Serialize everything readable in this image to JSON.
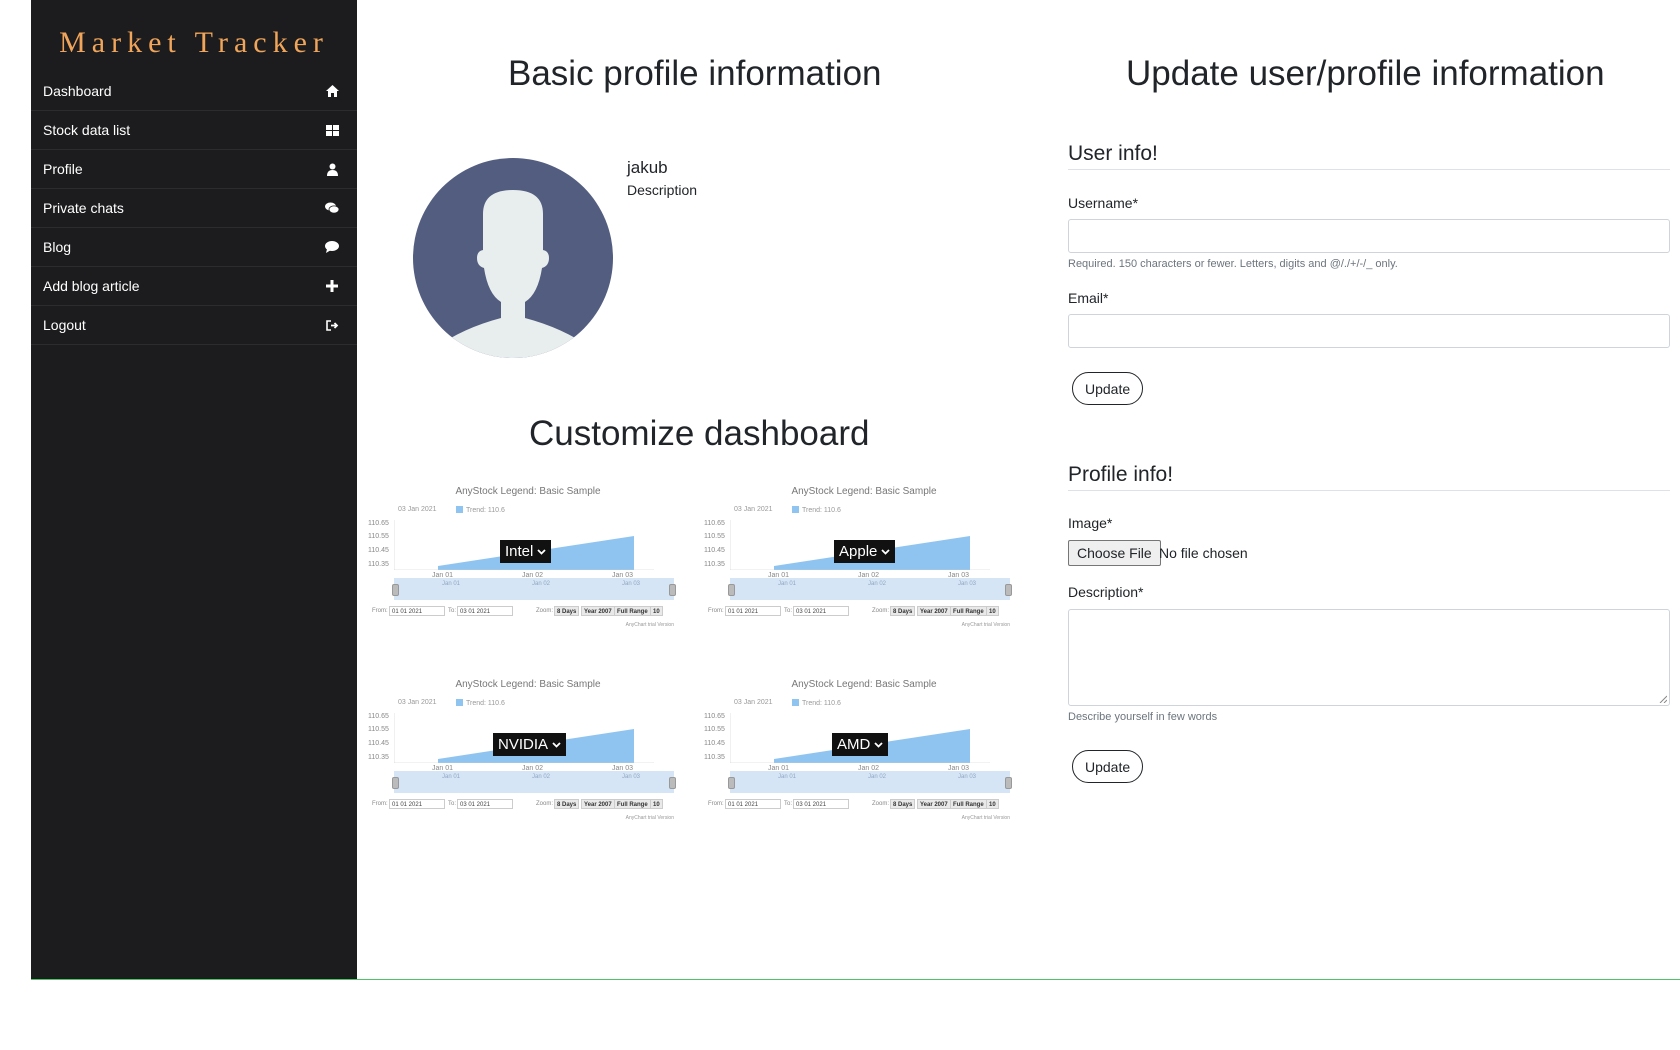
{
  "app": {
    "brand": "Market Tracker"
  },
  "sidebar": {
    "items": [
      {
        "label": "Dashboard",
        "icon": "home-icon"
      },
      {
        "label": "Stock data list",
        "icon": "grid-icon"
      },
      {
        "label": "Profile",
        "icon": "user-icon"
      },
      {
        "label": "Private chats",
        "icon": "comments-icon"
      },
      {
        "label": "Blog",
        "icon": "comment-icon"
      },
      {
        "label": "Add blog article",
        "icon": "plus-icon"
      },
      {
        "label": "Logout",
        "icon": "sign-out-icon"
      }
    ]
  },
  "profile": {
    "title": "Basic profile information",
    "username": "jakub",
    "description": "Description"
  },
  "dashboard": {
    "title": "Customize dashboard",
    "chart_template": {
      "title": "AnyStock Legend: Basic Sample",
      "date_label": "03 Jan 2021",
      "trend_label": "Trend: 110.6",
      "y_ticks": [
        "110.65",
        "110.55",
        "110.45",
        "110.35"
      ],
      "x_ticks": [
        "Jan 01",
        "Jan 02",
        "Jan 03"
      ],
      "from_label": "From:",
      "from_value": "01 01 2021",
      "to_label": "To:",
      "to_value": "03 01 2021",
      "zoom_label": "Zoom:",
      "zoom_buttons": [
        "8 Days",
        "Year 2007",
        "Full Range",
        "10"
      ],
      "credit": "AnyChart trial Version"
    },
    "widgets": [
      {
        "selected": "Intel"
      },
      {
        "selected": "Apple"
      },
      {
        "selected": "NVIDIA"
      },
      {
        "selected": "AMD"
      }
    ]
  },
  "update": {
    "title": "Update user/profile information",
    "user_info": {
      "heading": "User info!",
      "username_label": "Username*",
      "username_help": "Required. 150 characters or fewer. Letters, digits and @/./+/-/_ only.",
      "email_label": "Email*",
      "button": "Update"
    },
    "profile_info": {
      "heading": "Profile info!",
      "image_label": "Image*",
      "file_button": "Choose File",
      "file_status": "No file chosen",
      "description_label": "Description*",
      "description_help": "Describe yourself in few words",
      "button": "Update"
    }
  },
  "colors": {
    "sidebar_bg": "#1c1c1e",
    "brand": "#f0a55a",
    "avatar_bg": "#525d80",
    "chart_area": "#90c4f0",
    "bottom_line": "#52c266"
  }
}
